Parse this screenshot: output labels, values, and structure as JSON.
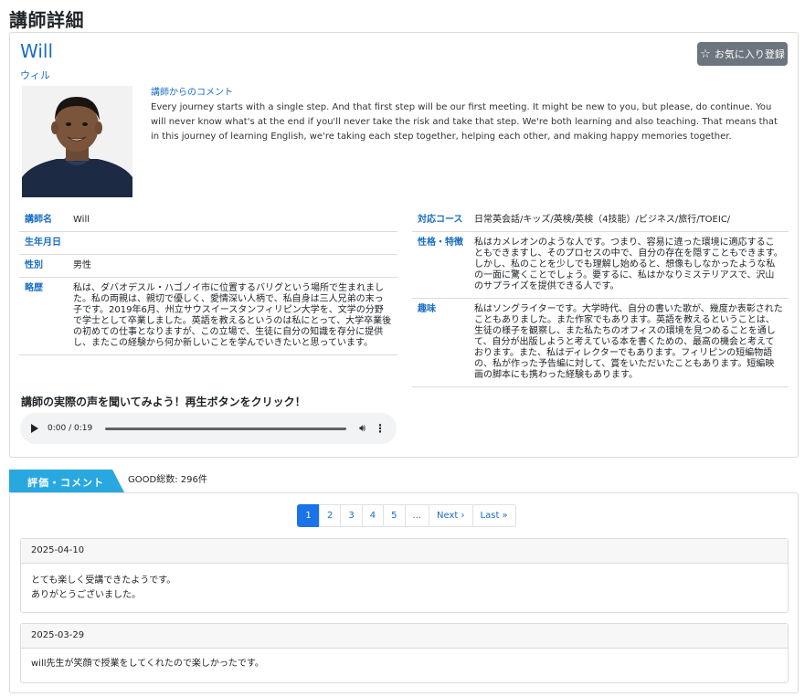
{
  "page": {
    "title": "講師詳細"
  },
  "teacher": {
    "name": "Will",
    "name_kana": "ウィル",
    "favorite_button": "お気に入り登録",
    "comment_label": "講師からのコメント",
    "comment": "Every journey starts with a single step. And that first step will be our first meeting. It might be new to you, but please, do continue. You will never know what's at the end if you'll never take the risk and take that step. We're both learning and also teaching. That means that in this journey of learning English, we're taking each step together, helping each other, and making happy memories together."
  },
  "info_left": [
    {
      "key": "講師名",
      "value": "Will"
    },
    {
      "key": "生年月日",
      "value": ""
    },
    {
      "key": "性別",
      "value": "男性"
    },
    {
      "key": "略歴",
      "value": "私は、ダバオデスル・ハゴノイ市に位置するバリグという場所で生まれました。私の両親は、親切で優しく、愛情深い人柄で、私自身は三人兄弟の末っ子です。2019年6月、州立サウスイースタンフィリピン大学を、文学の分野で学士として卒業しました。英語を教えるというのは私にとって、大学卒業後の初めての仕事となりますが、この立場で、生徒に自分の知識を存分に提供し、またこの経験から何か新しいことを学んでいきたいと思っています。"
    }
  ],
  "info_right": [
    {
      "key": "対応コース",
      "value": "日常英会話/キッズ/英検/英検（4技能）/ビジネス/旅行/TOEIC/"
    },
    {
      "key": "性格・特徴",
      "value": "私はカメレオンのような人です。つまり、容易に違った環境に適応することもできますし、そのプロセスの中で、自分の存在を隠すこともできます。しかし、私のことを少しでも理解し始めると、想像もしなかったような私の一面に驚くことでしょう。要するに、私はかなりミステリアスで、沢山のサプライズを提供できる人です。"
    },
    {
      "key": "趣味",
      "value": "私はソングライターです。大学時代、自分の書いた歌が、幾度か表彰されたこともありました。また作家でもあります。英語を教えるということは、生徒の様子を観察し、また私たちのオフィスの環境を見つめることを通して、自分が出版しようと考えている本を書くための、最高の機会と考えております。また、私はディレクターでもあります。フィリピンの短編物語の、私が作った予告編に対して、賞をいただいたこともあります。短編映画の脚本にも携わった経験もあります。"
    }
  ],
  "voice": {
    "title": "講師の実際の声を聞いてみよう！再生ボタンをクリック！",
    "time": "0:00 / 0:19"
  },
  "reviews_section": {
    "tab_label": "評価・コメント",
    "good_count": "GOOD総数: 296件",
    "pagination": [
      "1",
      "2",
      "3",
      "4",
      "5",
      "...",
      "Next ›",
      "Last »"
    ],
    "reviews": [
      {
        "date": "2025-04-10",
        "lines": [
          "とても楽しく受講できたようです。",
          "ありがとうございました。"
        ]
      },
      {
        "date": "2025-03-29",
        "lines": [
          "will先生が笑顔で授業をしてくれたので楽しかったです。"
        ]
      }
    ]
  },
  "colors": {
    "accent": "#1a6ec4",
    "tab": "#29a8e0",
    "button": "#6c757d",
    "active_page": "#1a73e8"
  }
}
